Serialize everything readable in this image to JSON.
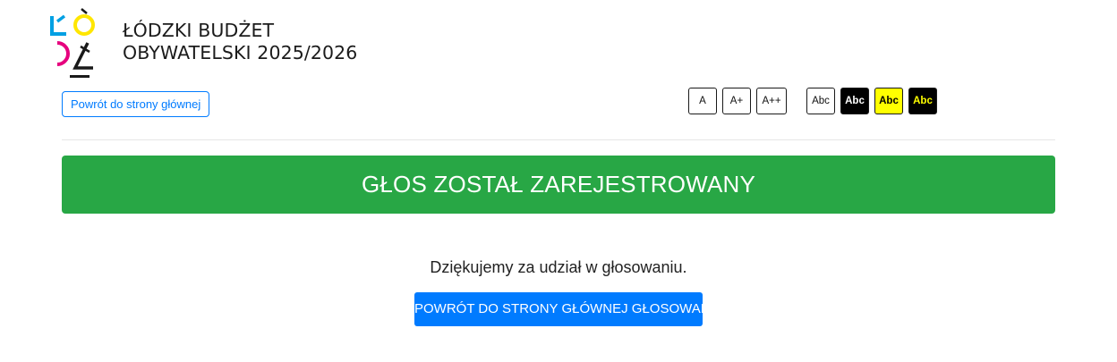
{
  "header": {
    "title_line1": "ŁÓDZKI BUDŻET",
    "title_line2": "OBYWATELSKI 2025/2026",
    "back_link": "Powrót do strony głównej"
  },
  "accessibility": {
    "font_sizes": [
      "A",
      "A+",
      "A++"
    ],
    "contrasts": [
      "Abc",
      "Abc",
      "Abc",
      "Abc"
    ]
  },
  "main": {
    "alert": "GŁOS ZOSTAŁ ZAREJESTROWANY",
    "thanks": "Dziękujemy za udział w głosowaniu.",
    "cta": "POWRÓT DO STRONY GŁÓWNEJ GŁOSOWANIA"
  },
  "colors": {
    "success": "#28a745",
    "primary": "#007bff",
    "logo_cyan": "#00a0e3",
    "logo_yellow": "#ffe600",
    "logo_magenta": "#e6007e",
    "logo_black": "#1a1a1a"
  }
}
